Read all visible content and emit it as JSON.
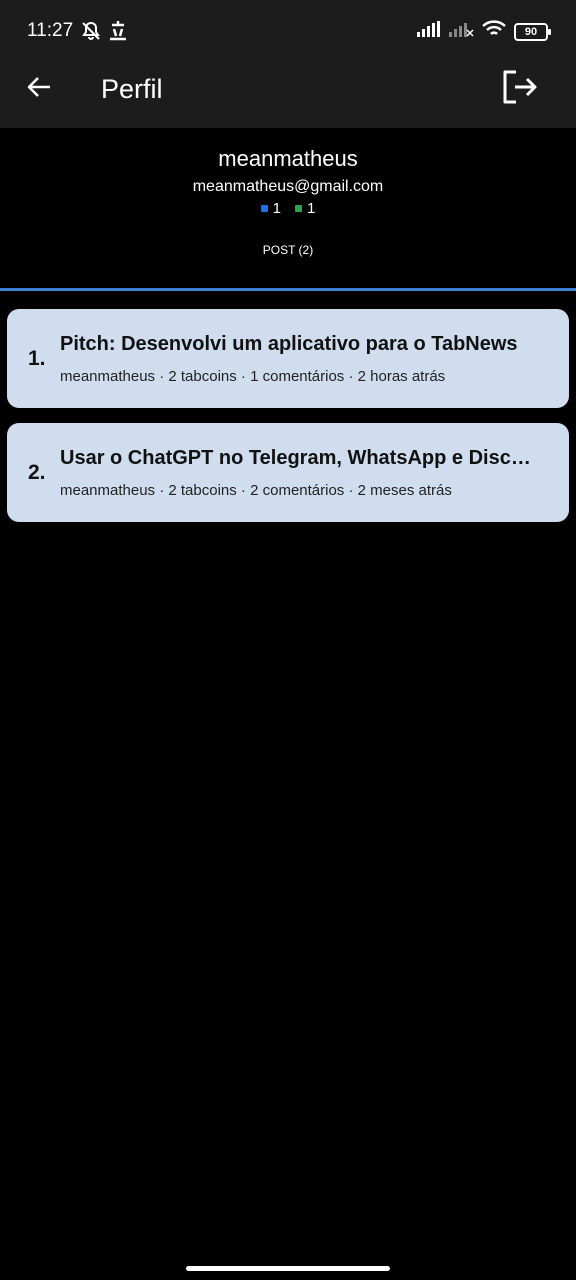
{
  "status_bar": {
    "time": "11:27",
    "battery": "90",
    "icons": [
      "bell-off-icon",
      "app-notification-icon",
      "signal-icon",
      "signal-off-icon",
      "wifi-icon",
      "battery-icon"
    ]
  },
  "app_bar": {
    "title": "Perfil",
    "back_icon": "arrow-left-icon",
    "logout_icon": "logout-icon"
  },
  "profile": {
    "username": "meanmatheus",
    "email": "meanmatheus@gmail.com",
    "counts": [
      {
        "value": "1",
        "color": "#1a73e8"
      },
      {
        "value": "1",
        "color": "#2ea44f"
      }
    ]
  },
  "tabs": [
    {
      "label": "POST (2)",
      "active": true
    }
  ],
  "colors": {
    "accent": "#3b82d6",
    "card_bg": "#d0ddef",
    "background": "#000000",
    "bar_bg": "#1c1c1c"
  },
  "posts": [
    {
      "index": "1.",
      "title": "Pitch: Desenvolvi um aplicativo para o TabNews",
      "meta": "meanmatheus · 2 tabcoins · 1 comentários · 2 horas atrás"
    },
    {
      "index": "2.",
      "title": "Usar o ChatGPT no Telegram, WhatsApp e Disco…",
      "meta": "meanmatheus · 2 tabcoins · 2 comentários · 2 meses atrás"
    }
  ]
}
